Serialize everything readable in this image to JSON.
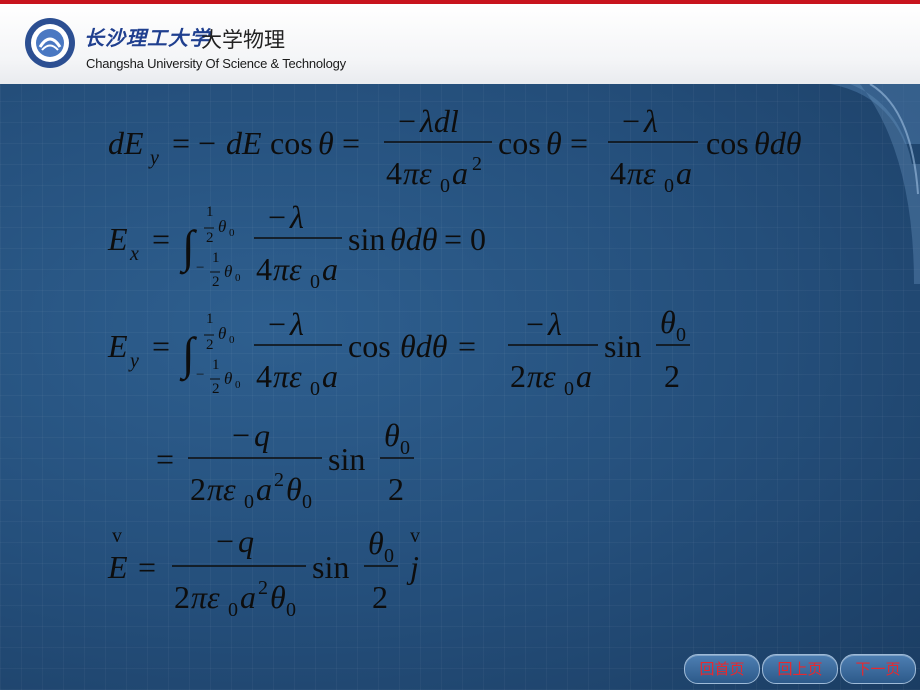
{
  "header": {
    "university_cn": "长沙理工大学",
    "course": "大学物理",
    "university_en": "Changsha University Of Science & Technology"
  },
  "nav": {
    "home": "回首页",
    "back": "回上页",
    "next": "下一页"
  },
  "colors": {
    "accent_bar": "#c8141e",
    "content_bg": "#244e7a",
    "nav_text": "#e8282d"
  }
}
